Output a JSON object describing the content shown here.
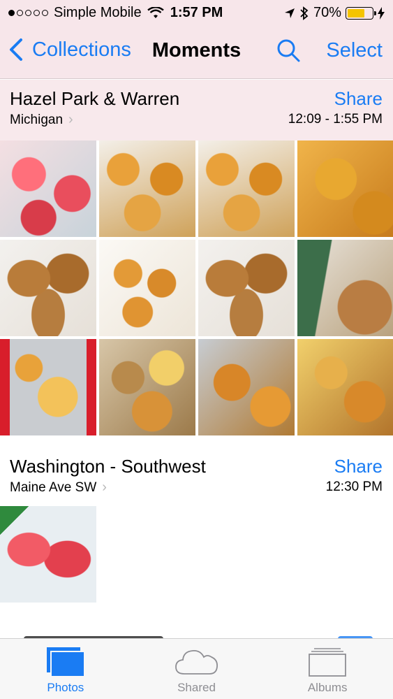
{
  "status_bar": {
    "carrier": "Simple Mobile",
    "time": "1:57 PM",
    "battery": "70%",
    "battery_level": 0.7,
    "signal_bars": 1,
    "signal_total": 5
  },
  "nav": {
    "back_label": "Collections",
    "title": "Moments",
    "select_label": "Select"
  },
  "sections": [
    {
      "title": "Hazel Park & Warren",
      "subtitle": "Michigan",
      "share_label": "Share",
      "time_range": "12:09 - 1:55 PM",
      "photos": [
        "fish",
        "shrimp-platter",
        "shrimp-platter",
        "fried-shrimp",
        "fish-fillets",
        "chicken-wings",
        "fish-fillets",
        "bagged-wings",
        "tray-shrimp",
        "tray-mix",
        "tray-mix",
        "tray-mix"
      ]
    },
    {
      "title": "Washington - Southwest",
      "subtitle": "Maine Ave SW",
      "share_label": "Share",
      "time_range": "12:30 PM",
      "photos": [
        "red-fish"
      ]
    }
  ],
  "tabs": [
    {
      "label": "Photos",
      "icon": "photos-icon",
      "active": true
    },
    {
      "label": "Shared",
      "icon": "cloud-icon",
      "active": false
    },
    {
      "label": "Albums",
      "icon": "albums-icon",
      "active": false
    }
  ],
  "colors": {
    "accent": "#1a7cf3",
    "header_tint": "#f7e6ea",
    "battery": "#f5c400"
  }
}
